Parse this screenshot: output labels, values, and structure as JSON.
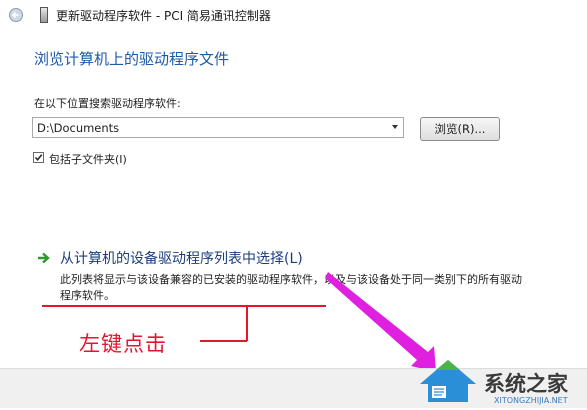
{
  "window": {
    "title": "更新驱动程序软件 - PCI 简易通讯控制器",
    "back_icon": "back-arrow-icon",
    "app_icon": "driver-icon"
  },
  "main": {
    "heading": "浏览计算机上的驱动程序文件",
    "search_label": "在以下位置搜索驱动程序软件:",
    "path_value": "D:\\Documents",
    "browse_label": "浏览(R)...",
    "include_subfolders_label": "包括子文件夹(I)",
    "include_subfolders_checked": true
  },
  "option": {
    "title": "从计算机的设备驱动程序列表中选择(L)",
    "description": "此列表将显示与该设备兼容的已安装的驱动程序软件，以及与该设备处于同一类别下的所有驱动程序软件。"
  },
  "annotation": {
    "text": "左键点击",
    "color": "#e3162e",
    "arrow_color": "#e020e0"
  },
  "watermark": {
    "name": "系统之家",
    "url": "XITONGZHIJIA.NET"
  }
}
